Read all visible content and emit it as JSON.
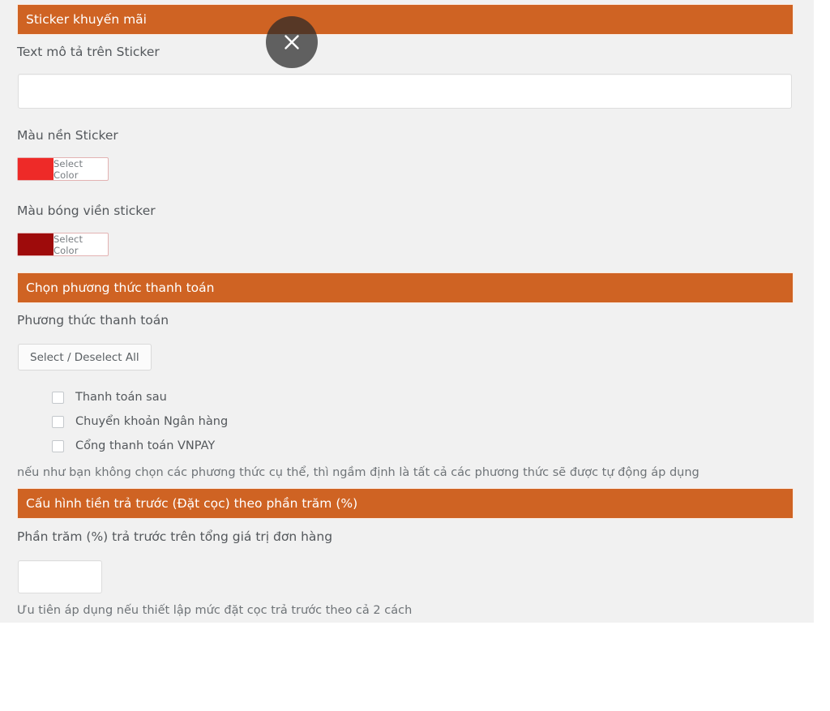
{
  "theme": {
    "accent_orange": "#cf6323",
    "panel_background": "#f1f1f1",
    "label_color": "#54585c",
    "note_color": "#6f7478"
  },
  "close_button": {
    "icon": "close-icon",
    "aria_label": "Close"
  },
  "cutoff_row": {
    "text": ""
  },
  "sections": {
    "sticker": {
      "header": "Sticker khuyến mãi",
      "text_label": "Text mô tả trên Sticker",
      "text_value": "",
      "text_placeholder": "",
      "bg_color_label": "Màu nền Sticker",
      "bg_color_button": "Select Color",
      "bg_color_value": "#ee2a28",
      "shadow_color_label": "Màu bóng viền sticker",
      "shadow_color_button": "Select Color",
      "shadow_color_value": "#9e0b0b"
    },
    "payment": {
      "header": "Chọn phương thức thanh toán",
      "label": "Phương thức thanh toán",
      "select_all_button": "Select / Deselect All",
      "methods": [
        {
          "label": "Thanh toán sau",
          "checked": false
        },
        {
          "label": "Chuyển khoản Ngân hàng",
          "checked": false
        },
        {
          "label": "Cổng thanh toán VNPAY",
          "checked": false
        }
      ],
      "note": "nếu như bạn không chọn các phương thức cụ thể, thì ngầm định là tất cả các phương thức sẽ được tự động áp dụng"
    },
    "deposit": {
      "header": "Cấu hình tiền trả trước (Đặt cọc) theo phần trăm (%)",
      "label": "Phần trăm (%) trả trước trên tổng giá trị đơn hàng",
      "value": "",
      "placeholder": "",
      "note": "Ưu tiên áp dụng nếu thiết lập mức đặt cọc trả trước theo cả 2 cách"
    }
  }
}
